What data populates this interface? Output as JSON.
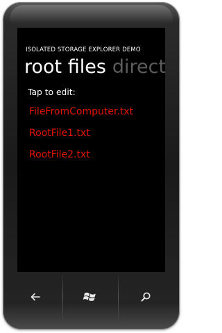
{
  "app": {
    "title": "ISOLATED STORAGE EXPLORER DEMO"
  },
  "pivot": {
    "items": [
      {
        "label": "root files",
        "active": true
      },
      {
        "label": "directories",
        "active": false
      }
    ]
  },
  "main": {
    "prompt": "Tap to edit:",
    "files": [
      {
        "name": "FileFromComputer.txt"
      },
      {
        "name": "RootFile1.txt"
      },
      {
        "name": "RootFile2.txt"
      }
    ]
  },
  "hardware_buttons": [
    {
      "icon": "back-arrow-icon"
    },
    {
      "icon": "windows-logo-icon"
    },
    {
      "icon": "search-icon"
    }
  ],
  "colors": {
    "accent": "#e51400",
    "background": "#000000",
    "foreground": "#ffffff",
    "inactive_pivot": "#5c5c5c"
  }
}
